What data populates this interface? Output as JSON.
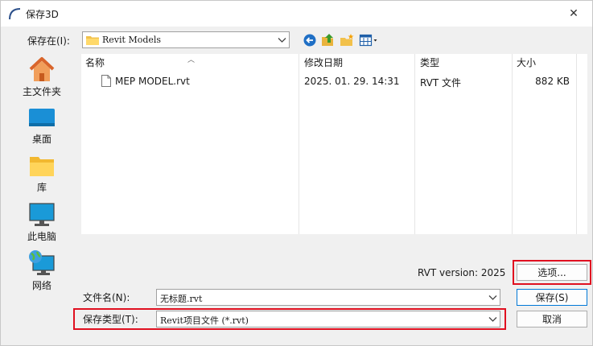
{
  "window": {
    "title": "保存3D",
    "close_glyph": "✕"
  },
  "lookin": {
    "label": "保存在(I):",
    "value": "Revit Models"
  },
  "places": [
    {
      "label": "主文件夹",
      "icon": "home-icon"
    },
    {
      "label": "桌面",
      "icon": "desktop-icon"
    },
    {
      "label": "库",
      "icon": "library-folder-icon"
    },
    {
      "label": "此电脑",
      "icon": "computer-icon"
    },
    {
      "label": "网络",
      "icon": "network-icon"
    }
  ],
  "filelist": {
    "columns": [
      "名称",
      "修改日期",
      "类型",
      "大小"
    ],
    "rows": [
      {
        "name": "MEP MODEL.rvt",
        "date": "2025. 01. 29. 14:31",
        "type": "RVT 文件",
        "size": "882 KB"
      }
    ]
  },
  "rvt_version": "RVT version: 2025",
  "buttons": {
    "options": "选项...",
    "save": "保存(S)",
    "cancel": "取消"
  },
  "filename": {
    "label": "文件名(N):",
    "value": "无标题.rvt"
  },
  "filetype": {
    "label": "保存类型(T):",
    "value": "Revit项目文件 (*.rvt)"
  },
  "colors": {
    "highlight": "#e01020",
    "accent": "#0078d7"
  }
}
